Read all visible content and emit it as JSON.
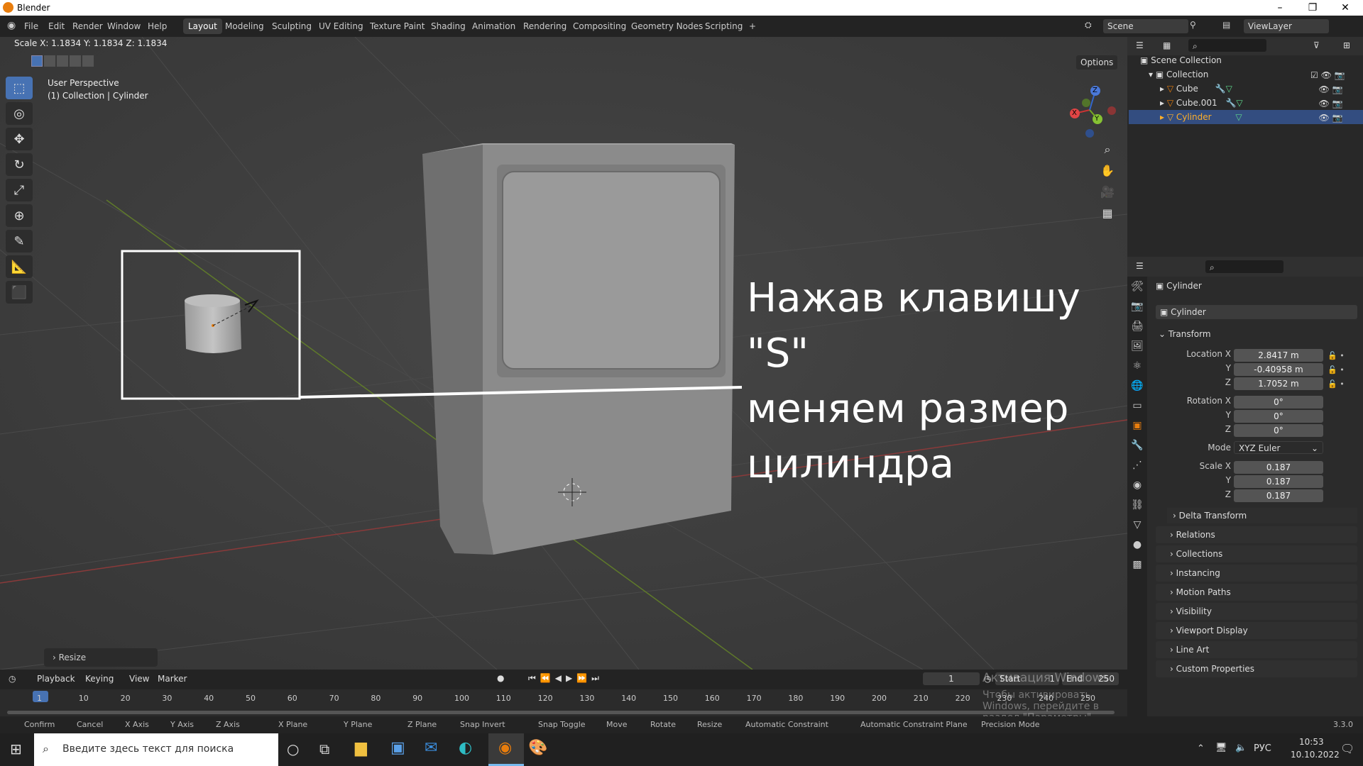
{
  "window": {
    "title": "Blender",
    "minimize": "–",
    "restore": "❐",
    "close": "✕"
  },
  "menus": [
    "File",
    "Edit",
    "Render",
    "Window",
    "Help"
  ],
  "workspaces": [
    "Layout",
    "Modeling",
    "Sculpting",
    "UV Editing",
    "Texture Paint",
    "Shading",
    "Animation",
    "Rendering",
    "Compositing",
    "Geometry Nodes",
    "Scripting",
    "+"
  ],
  "scene": {
    "name": "Scene",
    "viewlayer": "ViewLayer"
  },
  "viewport": {
    "scale_readout": "Scale X: 1.1834   Y: 1.1834  Z: 1.1834",
    "options": "Options",
    "perspective": "User Perspective",
    "context": "(1) Collection | Cylinder",
    "overlay_lines": [
      "Нажав клавишу \"S\"",
      "меняем размер",
      "цилиндра"
    ],
    "resize_panel": "Resize",
    "gizmo_axes": {
      "x": "X",
      "y": "Y",
      "z": "Z"
    }
  },
  "outliner": {
    "root": "Scene Collection",
    "collection": "Collection",
    "items": [
      "Cube",
      "Cube.001",
      "Cylinder"
    ]
  },
  "properties": {
    "object_name": "Cylinder",
    "object_field": "Cylinder",
    "transform_label": "Transform",
    "location": {
      "label": "Location X",
      "x": "2.8417 m",
      "y": "-0.40958 m",
      "z": "1.7052 m"
    },
    "rotation": {
      "label": "Rotation X",
      "x": "0°",
      "y": "0°",
      "z": "0°"
    },
    "mode_label": "Mode",
    "mode_value": "XYZ Euler",
    "scale": {
      "label": "Scale X",
      "x": "0.187",
      "y": "0.187",
      "z": "0.187"
    },
    "axis_y": "Y",
    "axis_z": "Z",
    "delta": "Delta Transform",
    "sections": [
      "Relations",
      "Collections",
      "Instancing",
      "Motion Paths",
      "Visibility",
      "Viewport Display",
      "Line Art",
      "Custom Properties"
    ]
  },
  "timeline": {
    "menus": [
      "Playback",
      "Keying",
      "View",
      "Marker"
    ],
    "current_frame": "1",
    "start_label": "Start",
    "start": "1",
    "end_label": "End",
    "end": "250",
    "ticks": [
      "1",
      "10",
      "20",
      "30",
      "40",
      "50",
      "60",
      "70",
      "80",
      "90",
      "100",
      "110",
      "120",
      "130",
      "140",
      "150",
      "160",
      "170",
      "180",
      "190",
      "200",
      "210",
      "220",
      "230",
      "240",
      "250"
    ],
    "watermark_1": "Активация Windows",
    "watermark_2": "Чтобы активировать Windows, перейдите в раздел \"Параметры\"."
  },
  "statusbar": {
    "items": [
      "Confirm",
      "Cancel",
      "X Axis",
      "Y Axis",
      "Z Axis",
      "X Plane",
      "Y Plane",
      "Z Plane",
      "Snap Invert",
      "Snap Toggle",
      "Move",
      "Rotate",
      "Resize",
      "Automatic Constraint",
      "Automatic Constraint Plane",
      "Precision Mode"
    ],
    "version": "3.3.0"
  },
  "taskbar": {
    "search_placeholder": "Введите здесь текст для поиска",
    "lang": "РУС",
    "time": "10:53",
    "date": "10.10.2022"
  },
  "colors": {
    "accent": "#4772b3",
    "selected_row": "#334d80",
    "orange": "#e87d0d"
  }
}
